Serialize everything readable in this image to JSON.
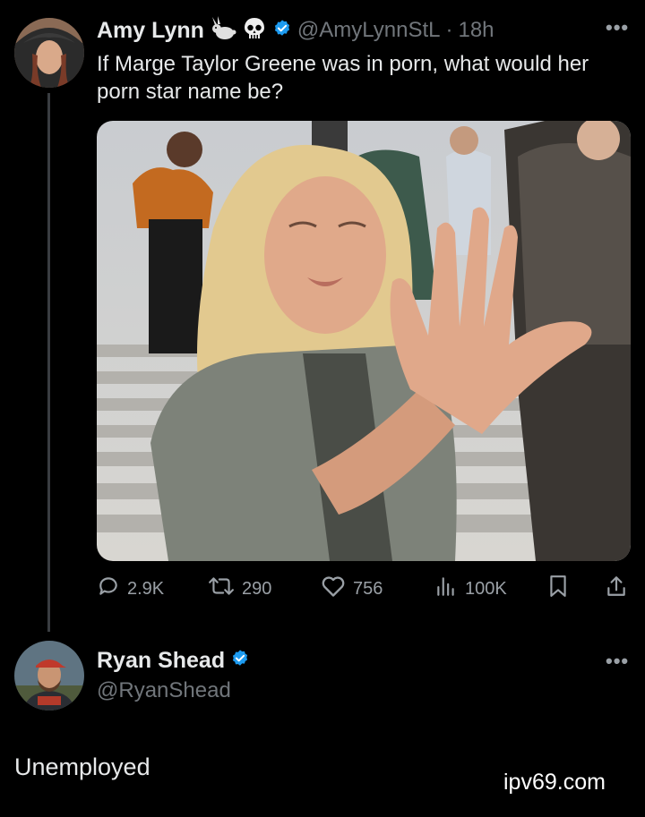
{
  "tweet": {
    "author": "Amy Lynn",
    "emoji_icons": [
      "rabbit-icon",
      "skull-icon"
    ],
    "handle": "@AmyLynnStL",
    "separator": "·",
    "time": "18h",
    "text": "If Marge Taylor Greene was in porn, what would her porn star name be?",
    "stats": {
      "replies": "2.9K",
      "reposts": "290",
      "likes": "756",
      "views": "100K"
    }
  },
  "reply": {
    "author": "Ryan Shead",
    "handle": "@RyanShead",
    "text": "Unemployed"
  },
  "watermark": "ipv69.com",
  "colors": {
    "background": "#000000",
    "text": "#e7e9ea",
    "muted": "#71767b",
    "verified": "#1d9bf0"
  }
}
